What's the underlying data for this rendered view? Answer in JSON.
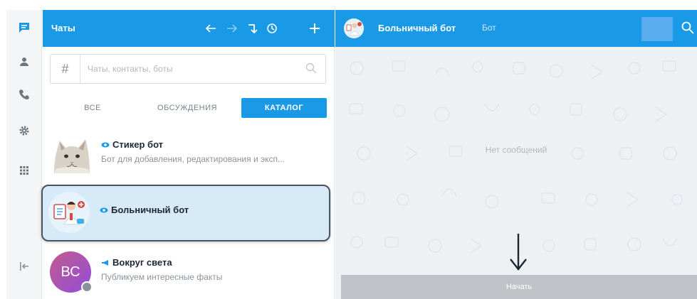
{
  "colors": {
    "accent": "#1a9ae6",
    "selected_bg": "#d6eaf8",
    "start_button": "#bfc3c7"
  },
  "rail": {
    "items": [
      {
        "icon": "chat-bubble-icon",
        "active": true
      },
      {
        "icon": "person-icon"
      },
      {
        "icon": "phone-icon"
      },
      {
        "icon": "gear-icon"
      },
      {
        "icon": "apps-grid-icon"
      },
      {
        "icon": "collapse-panel-icon"
      }
    ]
  },
  "panel": {
    "title": "Чаты",
    "header_icons": [
      "arrow-left-icon",
      "arrow-right-icon",
      "turn-arrow-icon",
      "history-icon",
      "plus-icon"
    ]
  },
  "search": {
    "hash": "#",
    "placeholder": "Чаты, контакты, боты"
  },
  "tabs": [
    {
      "label": "ВСЕ",
      "active": false
    },
    {
      "label": "ОБСУЖДЕНИЯ",
      "active": false
    },
    {
      "label": "КАТАЛОГ",
      "active": true
    }
  ],
  "chats": [
    {
      "name": "Стикер бот",
      "type": "bot",
      "description": "Бот для добавления, редактирования и эксп...",
      "avatar": "cat-photo"
    },
    {
      "name": "Больничный бот",
      "type": "bot",
      "description": "",
      "avatar": "doctor-illustration",
      "selected": true
    },
    {
      "name": "Вокруг света",
      "type": "channel",
      "description": "Публикуем интересные факты",
      "avatar_initials": "ВС"
    }
  ],
  "chat": {
    "name": "Больничный бот",
    "type_label": "Бот",
    "empty_text": "Нет сообщений",
    "start_button": "Начать"
  }
}
